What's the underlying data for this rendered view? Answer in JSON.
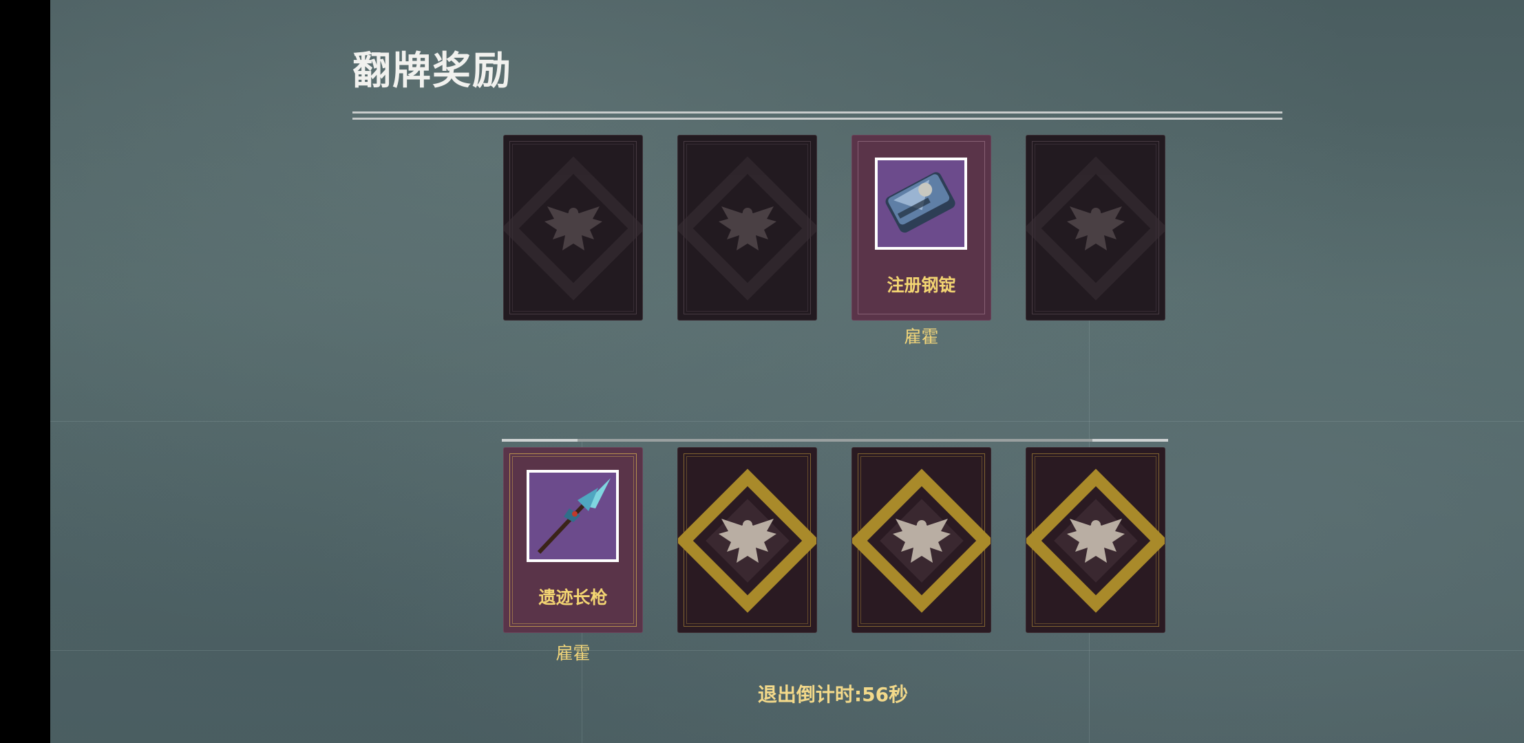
{
  "title": "翻牌奖励",
  "rows": [
    {
      "cards": [
        {
          "state": "back",
          "style": "dark"
        },
        {
          "state": "back",
          "style": "dark"
        },
        {
          "state": "revealed",
          "item_name": "注册钢锭",
          "item_icon": "steel-ingot-icon",
          "owner": "雇霍"
        },
        {
          "state": "back",
          "style": "dark"
        }
      ]
    },
    {
      "cards": [
        {
          "state": "revealed",
          "item_name": "遗迹长枪",
          "item_icon": "spear-icon",
          "owner": "雇霍"
        },
        {
          "state": "back",
          "style": "gold"
        },
        {
          "state": "back",
          "style": "gold"
        },
        {
          "state": "back",
          "style": "gold"
        }
      ]
    }
  ],
  "countdown_text": "退出倒计时:56秒",
  "colors": {
    "item_name": "#f3d572",
    "owner": "#f0d47a",
    "revealed_card_bg": "#5a3449",
    "item_box_bg": "#6c4b8c",
    "gold_accent": "#b8962e"
  }
}
